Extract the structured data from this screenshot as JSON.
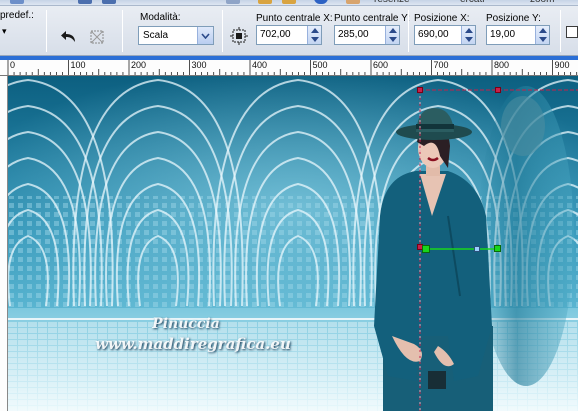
{
  "toolbar": {
    "preset_label": "predef.:",
    "top_texts": [
      "resenze",
      "ercati",
      "zoom"
    ]
  },
  "options": {
    "mode_label": "Modalità:",
    "mode_value": "Scala",
    "center_x_label": "Punto centrale X:",
    "center_x_value": "702,00",
    "center_y_label": "Punto centrale Y:",
    "center_y_value": "285,00",
    "pos_x_label": "Posizione X:",
    "pos_x_value": "690,00",
    "pos_y_label": "Posizione Y:",
    "pos_y_value": "19,00"
  },
  "ruler": {
    "ticks": [
      "0",
      "100",
      "200",
      "300",
      "400",
      "500",
      "600",
      "700",
      "800",
      "900"
    ]
  },
  "canvas": {
    "watermark_line1": "Pinuccia",
    "watermark_line2": "www.maddiregrafica.eu"
  },
  "colors": {
    "accent": "#2b6fd6",
    "selection_handle": "#c6204a",
    "pivot_handle": "#19d61c",
    "background_teal": "#0f6b8c"
  },
  "icons": {
    "undo": "undo-arrow-icon",
    "reset": "reset-transform-icon",
    "pick_center": "center-target-icon"
  }
}
